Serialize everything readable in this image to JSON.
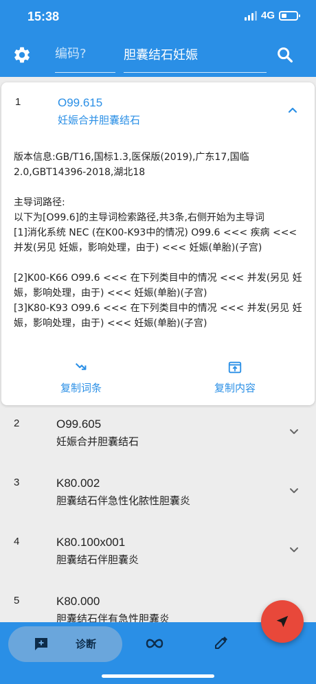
{
  "status_bar": {
    "time": "15:38",
    "network": "4G"
  },
  "search": {
    "code_placeholder": "编码?",
    "query_value": "胆囊结石妊娠"
  },
  "expanded": {
    "number": "1",
    "code": "O99.615",
    "name": "妊娠合并胆囊结石",
    "version_info": "版本信息:GB/T16,国标1.3,医保版(2019),广东17,国临2.0,GBT14396-2018,湖北18",
    "path_title": "主导词路径:",
    "path_intro": "以下为[O99.6]的主导词检索路径,共3条,右侧开始为主导词",
    "paths": [
      "[1]消化系统 NEC (在K00-K93中的情况) O99.6 <<< 疾病 <<< 并发(另见 妊娠，影响处理，由于) <<< 妊娠(单胎)(子宫)",
      "[2]K00-K66 O99.6 <<< 在下列类目中的情况 <<< 并发(另见 妊娠，影响处理，由于) <<< 妊娠(单胎)(子宫)",
      "[3]K80-K93 O99.6 <<< 在下列类目中的情况 <<< 并发(另见 妊娠，影响处理，由于) <<< 妊娠(单胎)(子宫)"
    ],
    "copy_entry_label": "复制词条",
    "copy_content_label": "复制内容"
  },
  "items": [
    {
      "number": "2",
      "code": "O99.605",
      "name": "妊娠合并胆囊结石"
    },
    {
      "number": "3",
      "code": "K80.002",
      "name": "胆囊结石伴急性化脓性胆囊炎"
    },
    {
      "number": "4",
      "code": "K80.100x001",
      "name": "胆囊结石伴胆囊炎"
    },
    {
      "number": "5",
      "code": "K80.000",
      "name": "胆囊结石伴有急性胆囊炎"
    }
  ],
  "bottom_bar": {
    "diagnosis_label": "诊断"
  },
  "colors": {
    "primary": "#2a8fe6",
    "fab": "#e8483a",
    "pill": "#6aa6dc"
  }
}
